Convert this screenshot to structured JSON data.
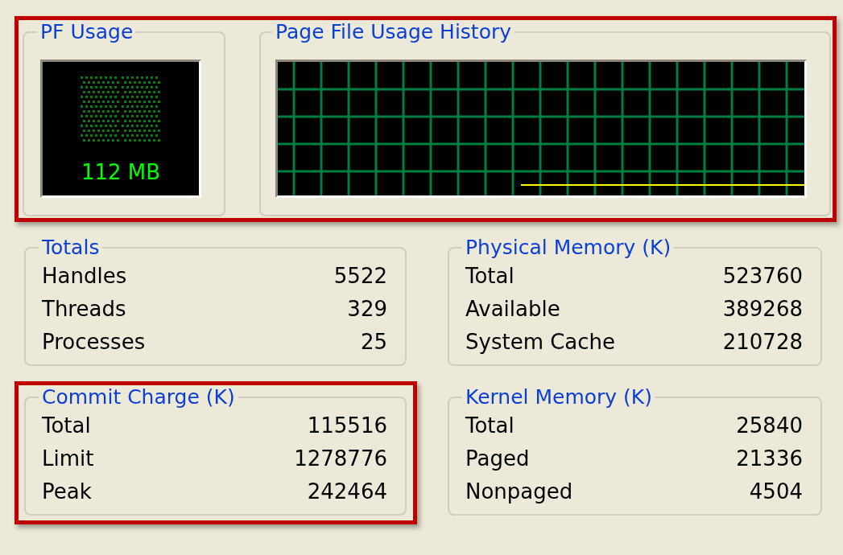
{
  "top_row": {
    "highlighted": true,
    "pf_usage": {
      "title": "PF Usage",
      "reading": "112 MB"
    },
    "history": {
      "title": "Page File Usage History"
    }
  },
  "groups": [
    {
      "title": "Totals",
      "highlighted": false,
      "rows": [
        {
          "label": "Handles",
          "value": "5522"
        },
        {
          "label": "Threads",
          "value": "329"
        },
        {
          "label": "Processes",
          "value": "25"
        }
      ]
    },
    {
      "title": "Physical Memory (K)",
      "highlighted": false,
      "rows": [
        {
          "label": "Total",
          "value": "523760"
        },
        {
          "label": "Available",
          "value": "389268"
        },
        {
          "label": "System Cache",
          "value": "210728"
        }
      ]
    },
    {
      "title": "Commit Charge (K)",
      "highlighted": true,
      "rows": [
        {
          "label": "Total",
          "value": "115516"
        },
        {
          "label": "Limit",
          "value": "1278776"
        },
        {
          "label": "Peak",
          "value": "242464"
        }
      ]
    },
    {
      "title": "Kernel Memory (K)",
      "highlighted": false,
      "rows": [
        {
          "label": "Total",
          "value": "25840"
        },
        {
          "label": "Paged",
          "value": "21336"
        },
        {
          "label": "Nonpaged",
          "value": "4504"
        }
      ]
    }
  ]
}
